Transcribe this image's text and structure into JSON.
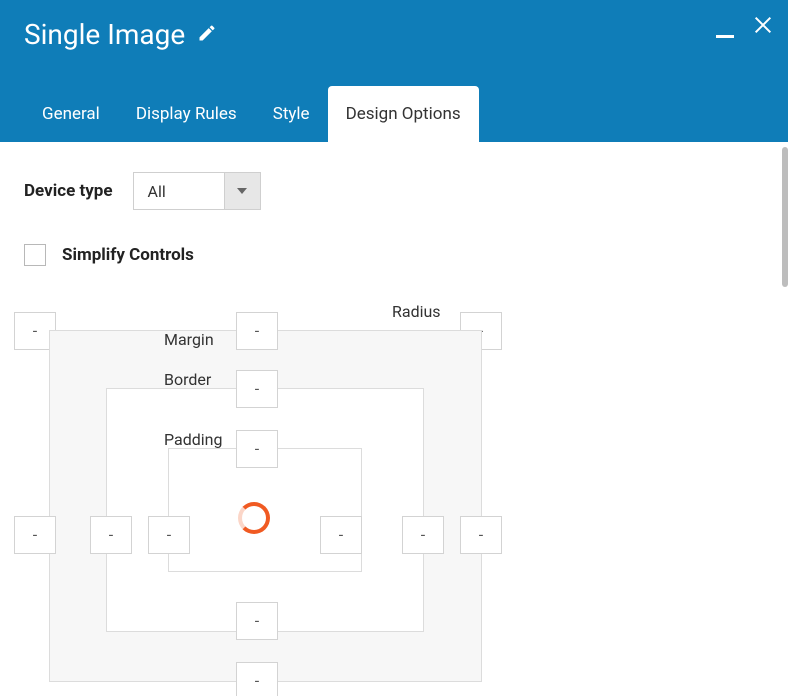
{
  "header": {
    "title": "Single Image"
  },
  "tabs": {
    "general": "General",
    "display_rules": "Display Rules",
    "style": "Style",
    "design_options": "Design Options"
  },
  "device": {
    "label": "Device type",
    "value": "All"
  },
  "simplify": {
    "label": "Simplify Controls",
    "checked": false
  },
  "boxmodel": {
    "radius_label": "Radius",
    "margin_label": "Margin",
    "border_label": "Border",
    "padding_label": "Padding",
    "radius_tl": "-",
    "radius_tr": "-",
    "margin_top": "-",
    "margin_left": "-",
    "margin_right": "-",
    "margin_bottom": "-",
    "border_top": "-",
    "border_left": "-",
    "border_right": "-",
    "border_bottom": "-",
    "padding_top": "-",
    "padding_left": "-",
    "padding_right": "-",
    "padding_bottom": "-"
  }
}
